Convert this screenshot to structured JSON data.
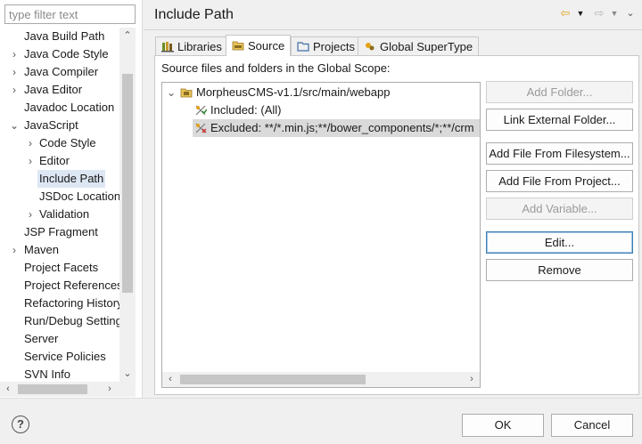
{
  "filter": {
    "placeholder": "type filter text"
  },
  "nav_tree": [
    {
      "label": "Java Build Path",
      "twisty": "",
      "selected": false
    },
    {
      "label": "Java Code Style",
      "twisty": "›",
      "selected": false
    },
    {
      "label": "Java Compiler",
      "twisty": "›",
      "selected": false
    },
    {
      "label": "Java Editor",
      "twisty": "›",
      "selected": false
    },
    {
      "label": "Javadoc Location",
      "twisty": "",
      "selected": false
    },
    {
      "label": "JavaScript",
      "twisty": "⌄",
      "selected": false
    },
    {
      "label": "Code Style",
      "twisty": "›",
      "selected": false
    },
    {
      "label": "Editor",
      "twisty": "›",
      "selected": false
    },
    {
      "label": "Include Path",
      "twisty": "",
      "selected": true
    },
    {
      "label": "JSDoc Location",
      "twisty": "",
      "selected": false
    },
    {
      "label": "Validation",
      "twisty": "›",
      "selected": false
    },
    {
      "label": "JSP Fragment",
      "twisty": "",
      "selected": false
    },
    {
      "label": "Maven",
      "twisty": "›",
      "selected": false
    },
    {
      "label": "Project Facets",
      "twisty": "",
      "selected": false
    },
    {
      "label": "Project References",
      "twisty": "",
      "selected": false
    },
    {
      "label": "Refactoring History",
      "twisty": "",
      "selected": false
    },
    {
      "label": "Run/Debug Settings",
      "twisty": "",
      "selected": false
    },
    {
      "label": "Server",
      "twisty": "",
      "selected": false
    },
    {
      "label": "Service Policies",
      "twisty": "",
      "selected": false
    },
    {
      "label": "SVN Info",
      "twisty": "",
      "selected": false
    }
  ],
  "header": {
    "title": "Include Path"
  },
  "tabs": [
    {
      "label": "Libraries",
      "icon": "libraries-icon",
      "active": false
    },
    {
      "label": "Source",
      "icon": "source-folder-icon",
      "active": true
    },
    {
      "label": "Projects",
      "icon": "projects-icon",
      "active": false
    },
    {
      "label": "Global SuperType",
      "icon": "supertype-icon",
      "active": false
    }
  ],
  "source_panel": {
    "caption": "Source files and folders in the Global Scope:",
    "tree": [
      {
        "label": "MorpheusCMS-v1.1/src/main/webapp",
        "icon": "package-folder-icon",
        "expanded": true,
        "selected": false
      },
      {
        "label": "Included: (All)",
        "icon": "inclusion-filter-icon",
        "selected": false
      },
      {
        "label": "Excluded: **/*.min.js;**/bower_components/*;**/crm",
        "icon": "exclusion-filter-icon",
        "selected": true
      }
    ]
  },
  "buttons": [
    {
      "label": "Add Folder...",
      "enabled": false
    },
    {
      "label": "Link External Folder...",
      "enabled": true
    },
    {
      "label": "Add File From Filesystem...",
      "enabled": true
    },
    {
      "label": "Add File From Project...",
      "enabled": true
    },
    {
      "label": "Add Variable...",
      "enabled": false
    },
    {
      "label": "Edit...",
      "enabled": true,
      "focused": true
    },
    {
      "label": "Remove",
      "enabled": true
    }
  ],
  "footer": {
    "ok_label": "OK",
    "cancel_label": "Cancel",
    "help_label": "?"
  },
  "colors": {
    "selection": "#dde6f3",
    "accent": "#e3a21a",
    "focus_border": "#3c7fb1"
  }
}
